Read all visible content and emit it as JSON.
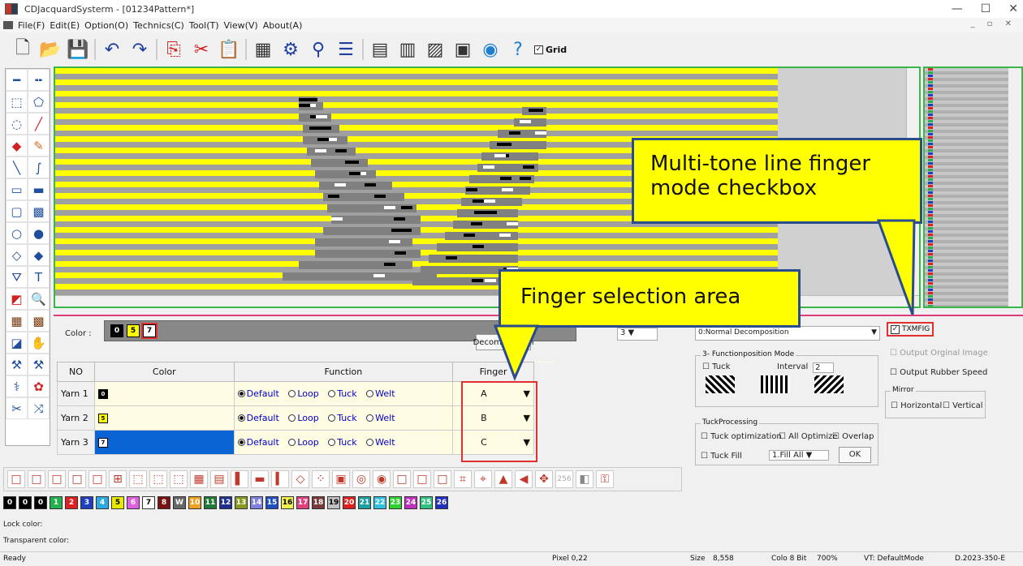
{
  "window": {
    "title": "CDJacquardSysterm - [01234Pattern*]",
    "minimize": "—",
    "maximize": "☐",
    "close": "✕"
  },
  "menu": [
    "File(F)",
    "Edit(E)",
    "Option(O)",
    "Technics(C)",
    "Tool(T)",
    "View(V)",
    "About(A)"
  ],
  "toolbar": {
    "grid_label": "Grid"
  },
  "lower": {
    "color_label": "Color :",
    "chips": [
      {
        "label": "0",
        "bg": "#000000",
        "fg": "#ffffff"
      },
      {
        "label": "5",
        "bg": "#ffff00",
        "fg": "#000000"
      },
      {
        "label": "7",
        "bg": "#ffffff",
        "fg": "#000000"
      }
    ],
    "decomposition_button": "Decomposition",
    "table_headers": {
      "no": "NO",
      "color": "Color",
      "function": "Function",
      "finger": "Finger"
    },
    "rows": [
      {
        "no": "Yarn 1",
        "chip": "0",
        "chip_bg": "#000000",
        "chip_fg": "#ffffff",
        "finger": "A"
      },
      {
        "no": "Yarn 2",
        "chip": "5",
        "chip_bg": "#ffff00",
        "chip_fg": "#000000",
        "finger": "B"
      },
      {
        "no": "Yarn 3",
        "chip": "7",
        "chip_bg": "#ffffff",
        "chip_fg": "#000000",
        "finger": "C"
      }
    ],
    "functions": [
      "Default",
      "Loop",
      "Tuck",
      "Welt"
    ],
    "decomp_select": "0:Normal Decomposition",
    "txmfig": "TXMFIG",
    "output_original": "Output Orginal Image",
    "output_rubber": "Output Rubber Speed",
    "mirror_title": "Mirror",
    "mirror_h": "Horizontal",
    "mirror_v": "Vertical",
    "fpm_title": "3- Functionposition Mode",
    "tuck": "Tuck",
    "interval_label": "Interval",
    "interval_value": "2",
    "tuckproc_title": "TuckProcessing",
    "tuck_opt": "Tuck optimization",
    "all_opt": "All Optimize",
    "overlap": "Overlap",
    "tuck_fill": "Tuck Fill",
    "fill_select": "1.Fill All",
    "ok": "OK",
    "small_select": "3"
  },
  "shapebar": {
    "count_label": "256"
  },
  "palette": [
    {
      "n": "0",
      "c": "#000000"
    },
    {
      "n": "0",
      "c": "#000000"
    },
    {
      "n": "0",
      "c": "#000000"
    },
    {
      "n": "1",
      "c": "#22b14c"
    },
    {
      "n": "2",
      "c": "#e02020"
    },
    {
      "n": "3",
      "c": "#1f3fbf"
    },
    {
      "n": "4",
      "c": "#2ea8e0"
    },
    {
      "n": "5",
      "c": "#e8e800"
    },
    {
      "n": "6",
      "c": "#e060e0"
    },
    {
      "n": "7",
      "c": "#ffffff"
    },
    {
      "n": "8",
      "c": "#7a1010"
    },
    {
      "n": "W",
      "c": "#666666"
    },
    {
      "n": "10",
      "c": "#f0a020"
    },
    {
      "n": "11",
      "c": "#1f7a3a"
    },
    {
      "n": "12",
      "c": "#1f2f8f"
    },
    {
      "n": "13",
      "c": "#8a9a20"
    },
    {
      "n": "14",
      "c": "#8080e0"
    },
    {
      "n": "15",
      "c": "#2050c0"
    },
    {
      "n": "16",
      "c": "#f0f050"
    },
    {
      "n": "17",
      "c": "#e04080"
    },
    {
      "n": "18",
      "c": "#7a3a3a"
    },
    {
      "n": "19",
      "c": "#c0c0c0"
    },
    {
      "n": "20",
      "c": "#e02020"
    },
    {
      "n": "21",
      "c": "#1fa0a0"
    },
    {
      "n": "22",
      "c": "#30c0e0"
    },
    {
      "n": "23",
      "c": "#30d030"
    },
    {
      "n": "24",
      "c": "#c030c0"
    },
    {
      "n": "25",
      "c": "#30c080"
    },
    {
      "n": "26",
      "c": "#2030c0"
    }
  ],
  "lock_color": "Lock color:",
  "transparent_color": "Transparent color:",
  "status": {
    "ready": "Ready",
    "pixel": "Pixel 0,22",
    "size_label": "Size",
    "size": "8,558",
    "colo": "Colo 8 Bit",
    "zoom": "700%",
    "vt": "VT: DefaultMode",
    "date": "D.2023-350-E"
  },
  "callouts": {
    "multitone": "Multi-tone line finger mode checkbox",
    "finger_area": "Finger selection area"
  }
}
